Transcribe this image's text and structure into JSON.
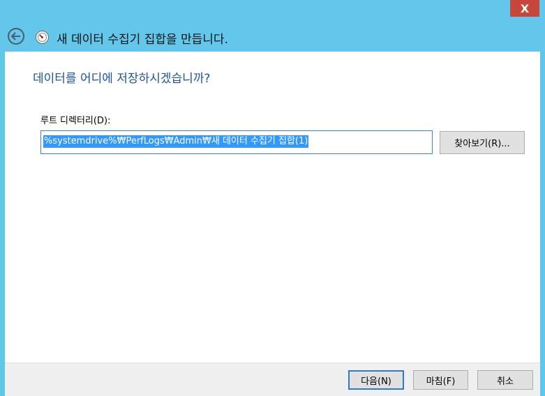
{
  "window": {
    "close_label": "X",
    "title": "새 데이터 수집기 집합을 만듭니다."
  },
  "page": {
    "heading": "데이터를 어디에 저장하시겠습니까?",
    "root_dir_label": "루트 디렉터리(D):",
    "root_dir_value": "%systemdrive%₩PerfLogs₩Admin₩새 데이터 수집기 집합(1)",
    "browse_label": "찾아보기(R)..."
  },
  "footer": {
    "next_label": "다음(N)",
    "finish_label": "마침(F)",
    "cancel_label": "취소"
  },
  "icons": {
    "back": "back-arrow-icon",
    "wizard": "performance-monitor-icon"
  },
  "colors": {
    "titlebar": "#62c7ea",
    "close": "#c9463d",
    "heading": "#1d53a6",
    "selection": "#3399ff"
  }
}
